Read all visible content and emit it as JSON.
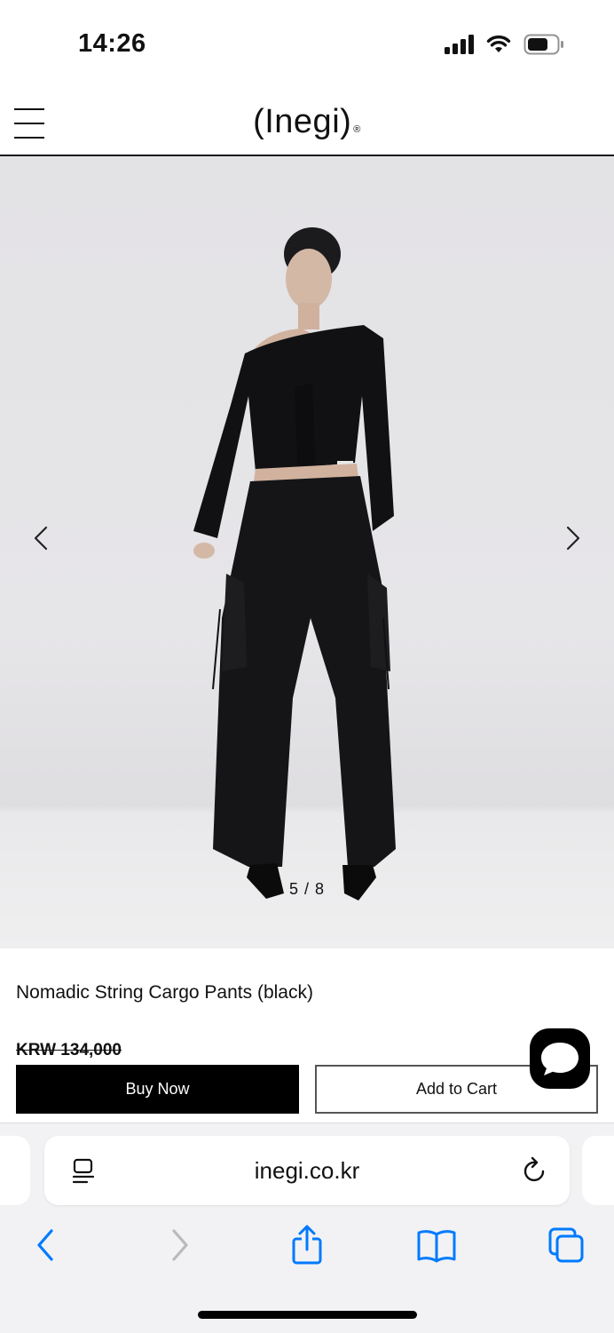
{
  "status_bar": {
    "time": "14:26"
  },
  "header": {
    "logo": "(Inegi)",
    "logo_mark": "®"
  },
  "gallery": {
    "counter": "5 / 8",
    "current": 5,
    "total": 8
  },
  "product": {
    "title": "Nomadic String Cargo Pants (black)",
    "price": "KRW 134,000",
    "buy_now_label": "Buy Now",
    "add_to_cart_label": "Add to Cart"
  },
  "browser": {
    "url": "inegi.co.kr"
  },
  "colors": {
    "accent": "#007aff",
    "primary_button": "#000000",
    "text": "#111111"
  }
}
